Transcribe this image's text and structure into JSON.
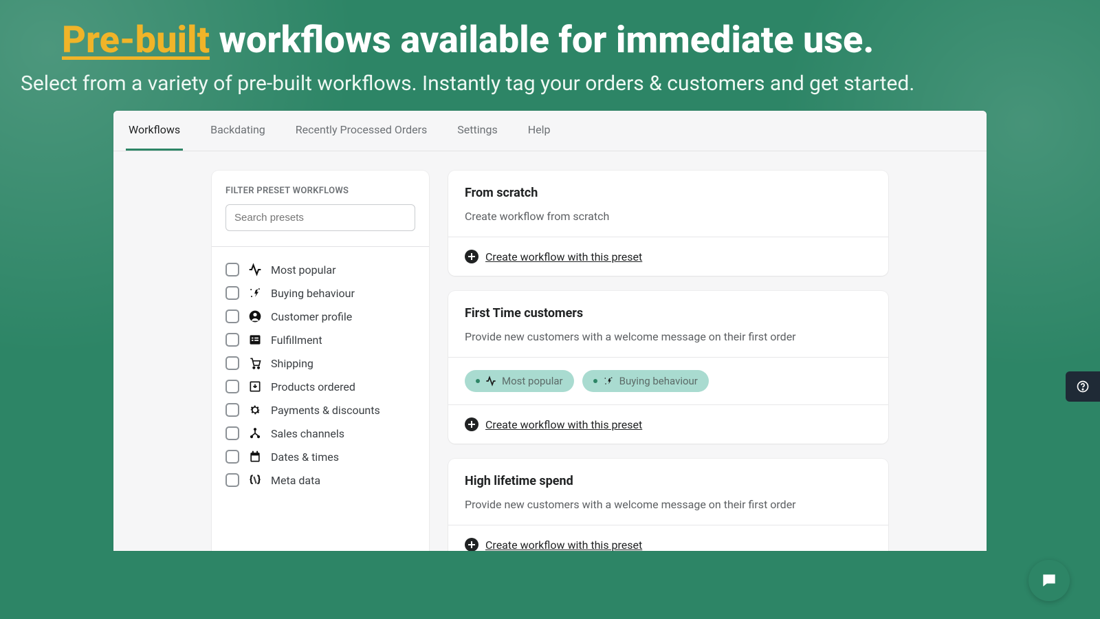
{
  "hero": {
    "accent": "Pre-built",
    "title_rest": " workflows available for immediate use.",
    "subtitle": "Select from a variety of pre-built workflows. Instantly tag your orders & customers and get started."
  },
  "tabs": [
    "Workflows",
    "Backdating",
    "Recently Processed Orders",
    "Settings",
    "Help"
  ],
  "active_tab": 0,
  "sidebar": {
    "title": "FILTER PRESET WORKFLOWS",
    "search_placeholder": "Search presets",
    "filters": [
      {
        "label": "Most popular",
        "icon": "activity"
      },
      {
        "label": "Buying behaviour",
        "icon": "spark"
      },
      {
        "label": "Customer profile",
        "icon": "person"
      },
      {
        "label": "Fulfillment",
        "icon": "list"
      },
      {
        "label": "Shipping",
        "icon": "cart"
      },
      {
        "label": "Products ordered",
        "icon": "box-down"
      },
      {
        "label": "Payments & discounts",
        "icon": "gear"
      },
      {
        "label": "Sales channels",
        "icon": "nodes"
      },
      {
        "label": "Dates & times",
        "icon": "calendar"
      },
      {
        "label": "Meta data",
        "icon": "braces"
      }
    ]
  },
  "cards": [
    {
      "title": "From scratch",
      "desc": "Create workflow from scratch",
      "tags": [],
      "action": "Create workflow with this preset"
    },
    {
      "title": "First Time customers",
      "desc": "Provide new customers with a welcome message on their first order",
      "tags": [
        {
          "label": "Most popular",
          "icon": "activity"
        },
        {
          "label": "Buying behaviour",
          "icon": "spark"
        }
      ],
      "action": "Create workflow with this preset"
    },
    {
      "title": "High lifetime spend",
      "desc": "Provide new customers with a welcome message on their first order",
      "tags": [],
      "action": "Create workflow with this preset"
    }
  ]
}
